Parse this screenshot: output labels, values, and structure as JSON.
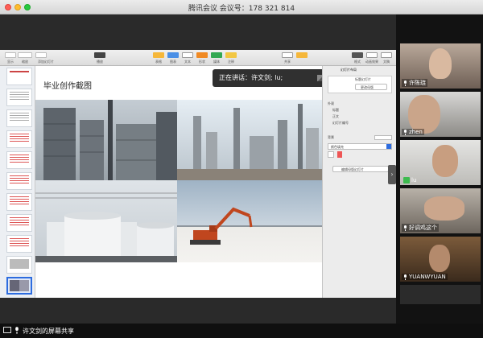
{
  "window": {
    "title": "腾讯会议 会议号：178 321 814"
  },
  "toolbar": {
    "left": [
      "显示",
      "缩放",
      "添加幻灯片"
    ],
    "center_play": "播放",
    "tools": [
      "表格",
      "图表",
      "文本",
      "形状",
      "媒体",
      "注释"
    ],
    "right": [
      "共享",
      "格式",
      "动画效果",
      "文稿"
    ]
  },
  "slide": {
    "title": "毕业创作截图"
  },
  "inspector": {
    "tab": "幻灯片布局",
    "master_label": "标题幻灯片",
    "change_master_button": "更改母版",
    "appear_heading": "外观",
    "checks": [
      "标题",
      "正文",
      "幻灯片编号"
    ],
    "background_heading": "背景",
    "background_value": "颜色填充",
    "edit_master_button": "编辑母版幻灯片"
  },
  "toast": {
    "text": "正在讲话：许文剑; lu;"
  },
  "participants": [
    {
      "name": "许陈琏"
    },
    {
      "name": "zhen"
    },
    {
      "name": "lu"
    },
    {
      "name": "好调鸡这个"
    },
    {
      "name": "YUANWYUAN"
    }
  ],
  "bottom": {
    "share_label": "许文剑的屏幕共享"
  },
  "colors": {
    "accent_green": "#3dbb4f",
    "selection_blue": "#2d6cdf"
  }
}
